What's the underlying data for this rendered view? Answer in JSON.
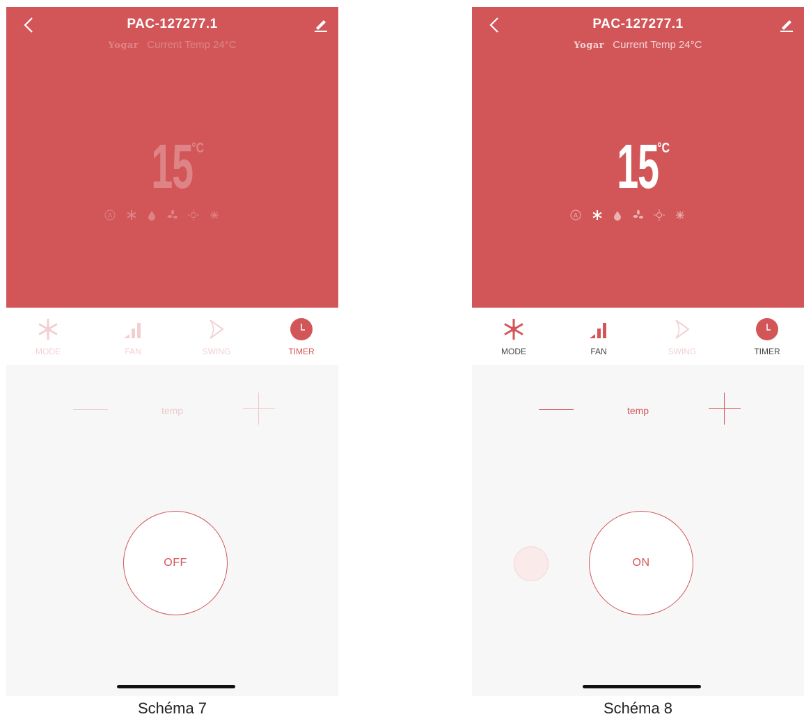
{
  "screens": [
    {
      "device_title": "PAC-127277.1",
      "brand": "Yogar",
      "current_temp": "Current Temp 24°C",
      "set_temp": "15",
      "temp_unit": "°C",
      "tabs": {
        "mode": "MODE",
        "fan": "FAN",
        "swing": "SWING",
        "timer": "TIMER"
      },
      "temp_label": "temp",
      "power_label": "OFF",
      "caption": "Schéma 7"
    },
    {
      "device_title": "PAC-127277.1",
      "brand": "Yogar",
      "current_temp": "Current Temp 24°C",
      "set_temp": "15",
      "temp_unit": "°C",
      "tabs": {
        "mode": "MODE",
        "fan": "FAN",
        "swing": "SWING",
        "timer": "TIMER"
      },
      "temp_label": "temp",
      "power_label": "ON",
      "caption": "Schéma 8"
    }
  ],
  "colors": {
    "accent": "#d25558",
    "background": "#f7f7f7"
  },
  "icons": [
    "back-icon",
    "edit-icon",
    "auto-icon",
    "snowflake-icon",
    "drop-icon",
    "fan-icon",
    "sun-icon",
    "cool-icon",
    "moon-icon",
    "fan-bars-icon",
    "swing-icon",
    "clock-icon"
  ]
}
